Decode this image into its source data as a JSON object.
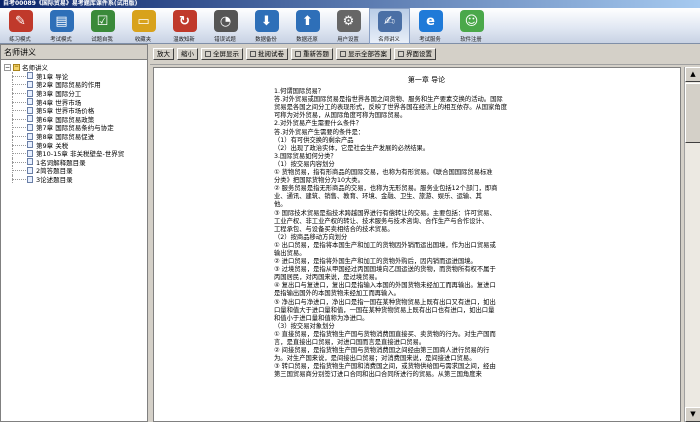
{
  "window": {
    "title": "自考00089《国际贸易》易考题库课件系(试用版)"
  },
  "toolbar": [
    {
      "name": "practice-mode",
      "label": "练习模式",
      "icon": "pencil-book-icon",
      "color": "#c0392b"
    },
    {
      "name": "exam-mode",
      "label": "考试模式",
      "icon": "exam-sheet-icon",
      "color": "#2e6fb8"
    },
    {
      "name": "test-self",
      "label": "试题自我",
      "icon": "checklist-icon",
      "color": "#3a8a3a"
    },
    {
      "name": "favorites",
      "label": "收藏夹",
      "icon": "folder-icon",
      "color": "#d8a21c"
    },
    {
      "name": "review-new",
      "label": "温故知新",
      "icon": "refresh-icon",
      "color": "#c0392b"
    },
    {
      "name": "error-collection",
      "label": "错误试题",
      "icon": "clock-icon",
      "color": "#555555"
    },
    {
      "name": "data-backup",
      "label": "数据备份",
      "icon": "backup-disk-icon",
      "color": "#2e6fb8"
    },
    {
      "name": "data-restore",
      "label": "数据还原",
      "icon": "restore-disk-icon",
      "color": "#2e6fb8"
    },
    {
      "name": "user-settings",
      "label": "用户设置",
      "icon": "gear-icon",
      "color": "#666666"
    },
    {
      "name": "famous-teacher",
      "label": "名师讲义",
      "icon": "notebook-pen-icon",
      "color": "#4a6fa5",
      "active": true
    },
    {
      "name": "exam-service",
      "label": "考试服务",
      "icon": "ie-browser-icon",
      "color": "#1f7ad8"
    },
    {
      "name": "software-register",
      "label": "软件注册",
      "icon": "people-icon",
      "color": "#4aa84a"
    }
  ],
  "sidebar": {
    "header": "名师讲义",
    "root": "名师讲义",
    "items": [
      "第1章 导论",
      "第2章 国际贸易的作用",
      "第3章 国际分工",
      "第4章 世界市场",
      "第5章 世界市场价格",
      "第6章 国际贸易政策",
      "第7章 国际贸易条约与协定",
      "第8章 国际贸易促进",
      "第9章 关税",
      "第10-15章 非关税壁垒-世界贸",
      "1名词解释题目录",
      "2简答题目录",
      "3论述题目录"
    ]
  },
  "actions": [
    {
      "name": "zoom-in",
      "label": "放大"
    },
    {
      "name": "zoom-out",
      "label": "缩小"
    },
    {
      "name": "fullscreen",
      "label": "全屏显示"
    },
    {
      "name": "annotate",
      "label": "批阅试卷"
    },
    {
      "name": "reset-question",
      "label": "重新答题"
    },
    {
      "name": "show-all-answers",
      "label": "显示全部答案"
    },
    {
      "name": "ui-settings",
      "label": "界面设置"
    }
  ],
  "document": {
    "chapter_title": "第一章 导论",
    "lines": [
      "1.何谓国际贸易？",
      "答.对外贸易或国际贸易是指世界各国之间货物、服务和生产要素交换的活动。国际",
      "贸易是各国之间分工的表现形式，反映了世界各国在经济上的相互依存。从国家角度",
      "可称为对外贸易，从国际角度可称为国际贸易。",
      "2.对外贸易产生需要什么条件？",
      "答.对外贸易产生需要的条件是：",
      "（1）有可供交换的剩余产品",
      "（2）出现了政治实体，它是社会生产发展的必然结果。",
      "3.国际贸易如何分类？",
      "（1）按交易内容划分",
      "① 货物贸易，指有形商品的国际交易，也称为有形贸易。《联合国国际贸易标准",
      "分类》把国际货物分为10大类。",
      "② 服务贸易是指无形商品的交易，也称为无形贸易。服务业包括12个部门，即商",
      "业、通讯、建筑、销售、教育、环境、金融、卫生、旅游、娱乐、运输、其",
      "他。",
      "③ 国际技术贸易是指技术跨越国界进行有偿转让的交易。主要包括：许可贸易、",
      "工业产权、非工业产权的转让、技术服务与技术咨询、合作生产与合作设计、",
      "工程承包、与设备买卖相结合的技术贸易。",
      "（2）按商品移动方向划分",
      "① 出口贸易，是指将本国生产和加工的货物因外销而运出国境，作为出口贸易或",
      "输出贸易。",
      "② 进口贸易，是指将外国生产和加工的货物外购后，因内销而运进国境。",
      "③ 过境贸易，是指从甲国经过丙国国境向乙国运送的货物，而货物所有权不属于",
      "丙国居民，对丙国来说，是过境贸易。",
      "④ 复出口与复进口，复出口是指输入本国的外国货物未经加工而再输出。复进口",
      "是指输出国外的本国货物未经加工而再输入。",
      "⑤ 净出口与净进口，净出口是指一国在某种货物贸易上既有出口又有进口，如出",
      "口量和值大于进口量和值，一国在某种货物贸易上既有出口也有进口，如出口量",
      "和值小于进口量和值称为净进口。",
      "（3）按交易对象划分",
      "① 直接贸易，是指货物生产国与货物消费国直接买、卖货物的行为。对生产国而",
      "言，是直接出口贸易，对进口国而言是直接进口贸易。",
      "② 间接贸易，是指货物生产国与货物消费国之间经由第三国商人进行贸易的行",
      "为。对生产国来说，是间接出口贸易；对消费国来说，是间接进口贸易。",
      "③ 转口贸易，是指货物生产国和消费国之间，或货物供给国与需求国之间，经由",
      "第三国贸易商分别签订进口合同和出口合同所进行的贸易。从第三国角度来"
    ]
  }
}
